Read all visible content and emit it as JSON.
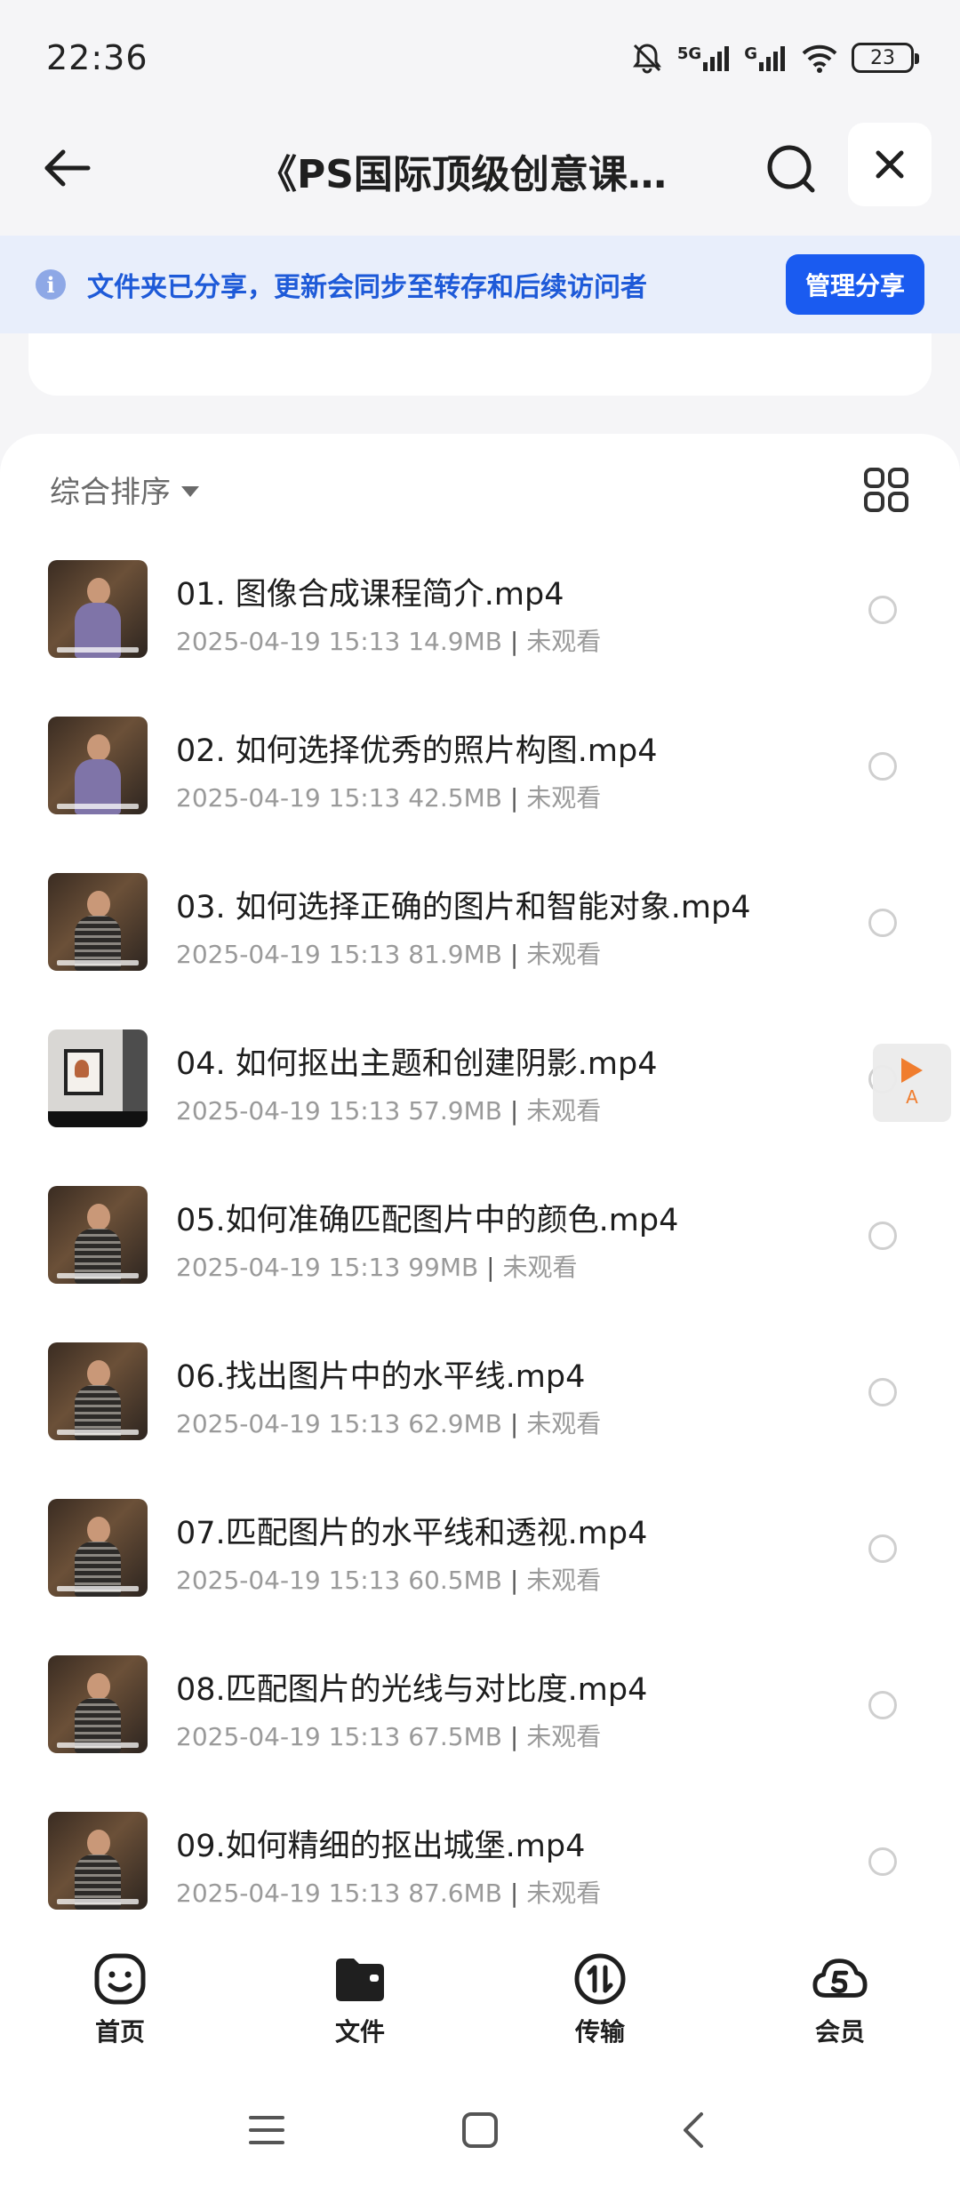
{
  "status_bar": {
    "time": "22:36",
    "network_5g": "5G",
    "network_g": "G",
    "battery": "23"
  },
  "header": {
    "title": "《PS国际顶级创意课程…"
  },
  "share_banner": {
    "text": "文件夹已分享，更新会同步至转存和后续访问者",
    "button": "管理分享"
  },
  "sort": {
    "label": "综合排序"
  },
  "files": [
    {
      "name": "01. 图像合成课程简介.mp4",
      "date": "2025-04-19 15:13",
      "size": "14.9MB",
      "status": "未观看",
      "thumb": "person-purple"
    },
    {
      "name": "02. 如何选择优秀的照片构图.mp4",
      "date": "2025-04-19 15:13",
      "size": "42.5MB",
      "status": "未观看",
      "thumb": "person-purple"
    },
    {
      "name": "03. 如何选择正确的图片和智能对象.mp4",
      "date": "2025-04-19 15:13",
      "size": "81.9MB",
      "status": "未观看",
      "thumb": "person-striped"
    },
    {
      "name": "04. 如何抠出主题和创建阴影.mp4",
      "date": "2025-04-19 15:13",
      "size": "57.9MB",
      "status": "未观看",
      "thumb": "screen"
    },
    {
      "name": "05.如何准确匹配图片中的颜色.mp4",
      "date": "2025-04-19 15:13",
      "size": "99MB",
      "status": "未观看",
      "thumb": "person-striped"
    },
    {
      "name": "06.找出图片中的水平线.mp4",
      "date": "2025-04-19 15:13",
      "size": "62.9MB",
      "status": "未观看",
      "thumb": "person-striped"
    },
    {
      "name": "07.匹配图片的水平线和透视.mp4",
      "date": "2025-04-19 15:13",
      "size": "60.5MB",
      "status": "未观看",
      "thumb": "person-striped"
    },
    {
      "name": "08.匹配图片的光线与对比度.mp4",
      "date": "2025-04-19 15:13",
      "size": "67.5MB",
      "status": "未观看",
      "thumb": "person-striped"
    },
    {
      "name": "09.如何精细的抠出城堡.mp4",
      "date": "2025-04-19 15:13",
      "size": "87.6MB",
      "status": "未观看",
      "thumb": "person-striped"
    }
  ],
  "float_player": {
    "letter": "A"
  },
  "tabs": [
    {
      "label": "首页",
      "icon": "smile-icon"
    },
    {
      "label": "文件",
      "icon": "folder-icon"
    },
    {
      "label": "传输",
      "icon": "transfer-icon"
    },
    {
      "label": "会员",
      "icon": "vip-cloud-icon"
    }
  ],
  "colors": {
    "accent": "#1a5bf0",
    "banner_bg": "#e8eefb",
    "banner_text": "#1e5ad8",
    "player_orange": "#f07d2e"
  }
}
